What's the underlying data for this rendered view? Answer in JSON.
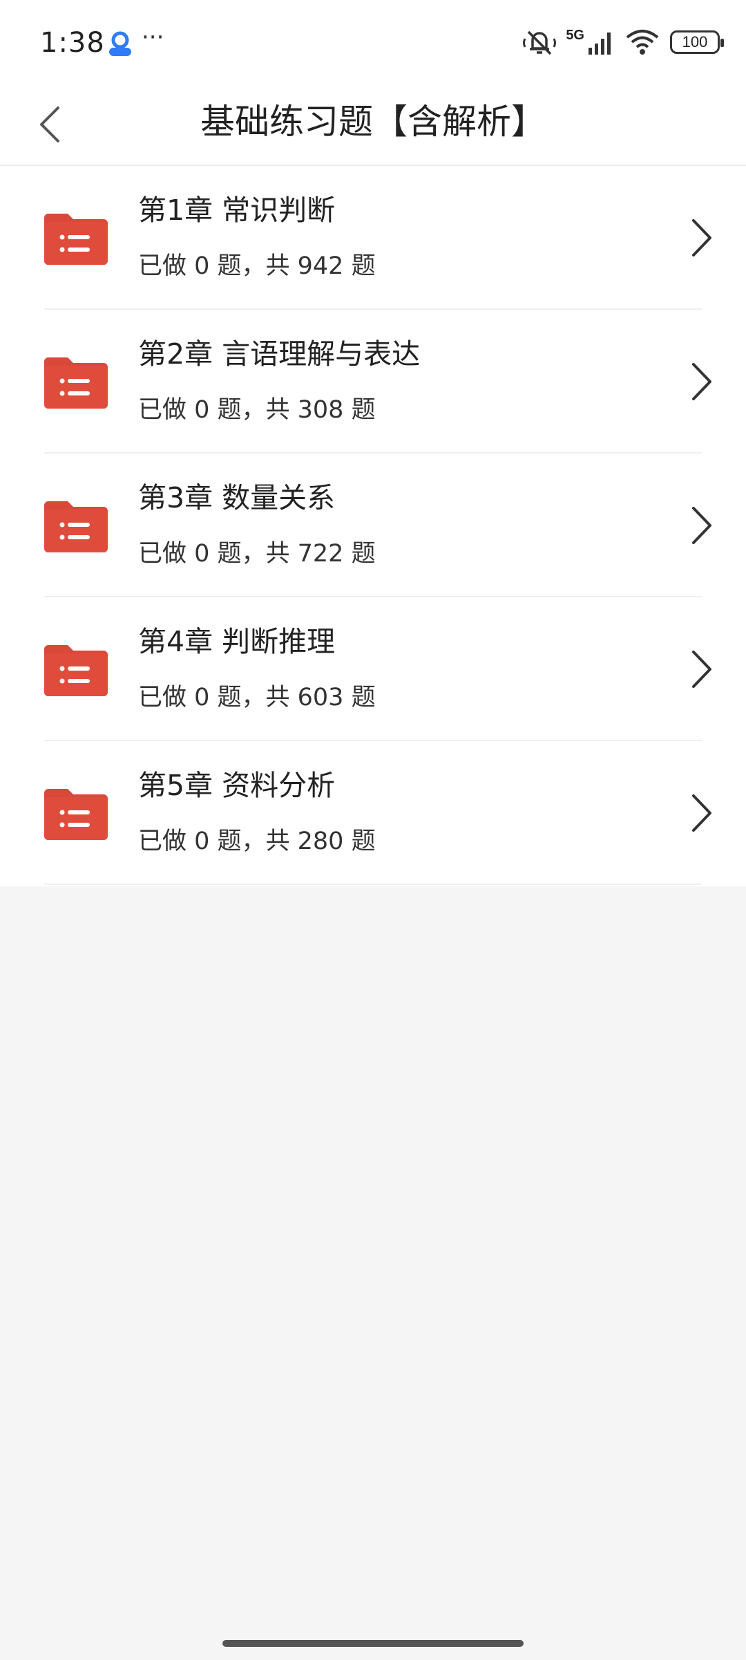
{
  "status_bar": {
    "time": "1:38",
    "more": "···",
    "network": "5G",
    "battery": "100"
  },
  "header": {
    "title": "基础练习题【含解析】"
  },
  "chapters": [
    {
      "title": "第1章 常识判断",
      "progress": "已做 0 题，共 942 题"
    },
    {
      "title": "第2章 言语理解与表达",
      "progress": "已做 0 题，共 308 题"
    },
    {
      "title": "第3章 数量关系",
      "progress": "已做 0 题，共 722 题"
    },
    {
      "title": "第4章 判断推理",
      "progress": "已做 0 题，共 603 题"
    },
    {
      "title": "第5章 资料分析",
      "progress": "已做 0 题，共 280 题"
    }
  ],
  "colors": {
    "folder": "#d9493a",
    "background": "#f5f5f5"
  }
}
